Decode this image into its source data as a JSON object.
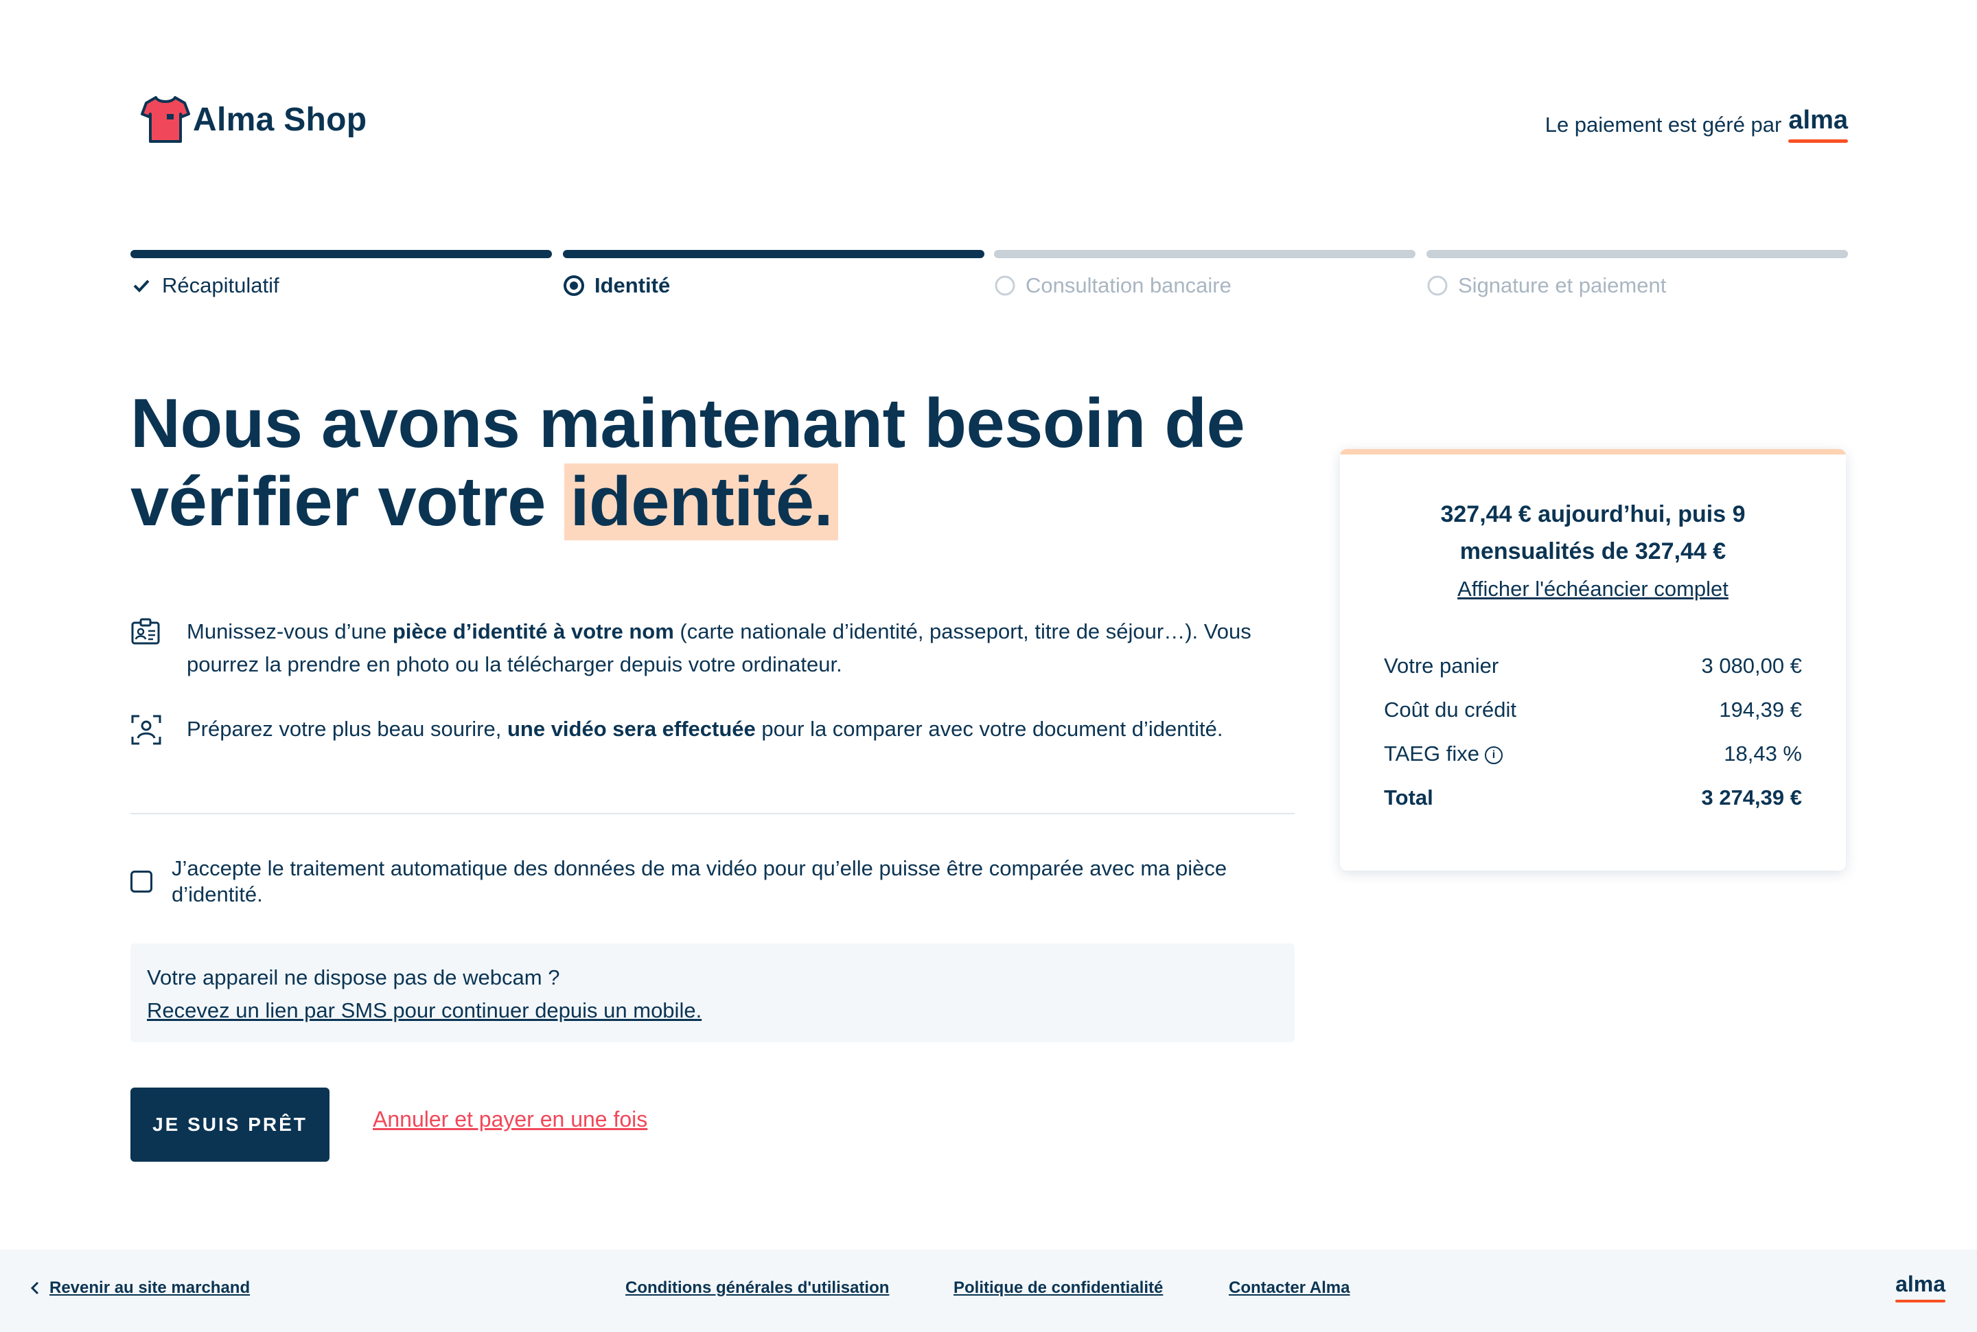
{
  "header": {
    "shop_name": "Alma Shop",
    "managed_by": "Le paiement est géré par",
    "provider": "alma"
  },
  "stepper": {
    "steps": [
      {
        "label": "Récapitulatif",
        "state": "done"
      },
      {
        "label": "Identité",
        "state": "active"
      },
      {
        "label": "Consultation bancaire",
        "state": "pending"
      },
      {
        "label": "Signature et paiement",
        "state": "pending"
      }
    ]
  },
  "main": {
    "heading_part1": "Nous avons maintenant besoin de vérifier votre ",
    "heading_highlight": "identité.",
    "info1": {
      "pre": "Munissez-vous d’une ",
      "bold": "pièce d’identité à votre nom",
      "post": " (carte nationale d’identité, passeport, titre de séjour…). Vous pourrez la prendre en photo ou la télécharger depuis votre ordinateur."
    },
    "info2": {
      "pre": "Préparez votre plus beau sourire, ",
      "bold": "une vidéo sera effectuée",
      "post": " pour la comparer avec votre document d’identité."
    },
    "consent_label": "J’accepte le traitement automatique des données de ma vidéo pour qu’elle puisse être comparée avec ma pièce d’identité.",
    "no_webcam_text": "Votre appareil ne dispose pas de webcam ?",
    "sms_link": "Recevez un lien par SMS pour continuer depuis un mobile.",
    "ready_button": "JE SUIS PRÊT",
    "cancel_link": "Annuler et payer en une fois"
  },
  "summary": {
    "headline": "327,44 € aujourd’hui, puis 9 mensualités de 327,44 €",
    "schedule_link": "Afficher l'échéancier complet",
    "rows": [
      {
        "label": "Votre panier",
        "value": "3 080,00 €"
      },
      {
        "label": "Coût du crédit",
        "value": "194,39 €"
      },
      {
        "label": "TAEG fixe",
        "value": "18,43 %"
      },
      {
        "label": "Total",
        "value": "3 274,39 €"
      }
    ]
  },
  "footer": {
    "back": "Revenir au site marchand",
    "terms": "Conditions générales d'utilisation",
    "privacy": "Politique de confidentialité",
    "contact": "Contacter Alma",
    "brand": "alma"
  },
  "colors": {
    "navy": "#0b3453",
    "highlight": "#fdd8bf",
    "accent_red": "#f0485a",
    "alma_orange": "#fa5022",
    "muted": "#a9b6c2"
  }
}
